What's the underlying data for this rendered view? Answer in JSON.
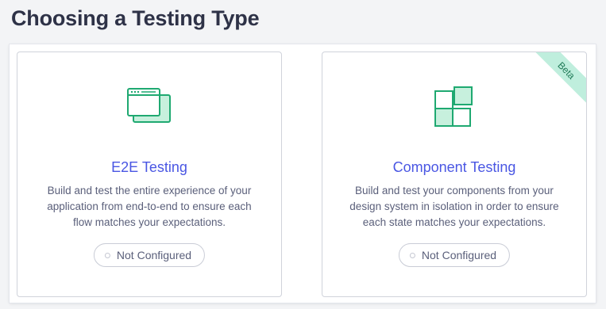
{
  "header": {
    "title": "Choosing a Testing Type"
  },
  "cards": [
    {
      "title": "E2E Testing",
      "description": "Build and test the entire experience of your application from end-to-end to ensure each flow matches your expectations.",
      "status": "Not Configured",
      "icon": "browser-windows-icon"
    },
    {
      "title": "Component Testing",
      "description": "Build and test your components from your design system in isolation in order to ensure each state matches your expectations.",
      "status": "Not Configured",
      "icon": "component-grid-icon",
      "badge": "Beta"
    }
  ],
  "colors": {
    "accent_title": "#4956e3",
    "icon_green": "#1fa971",
    "icon_green_fill": "#c7f0dd",
    "badge_bg": "#bfeedd",
    "badge_text": "#1f7a57"
  }
}
